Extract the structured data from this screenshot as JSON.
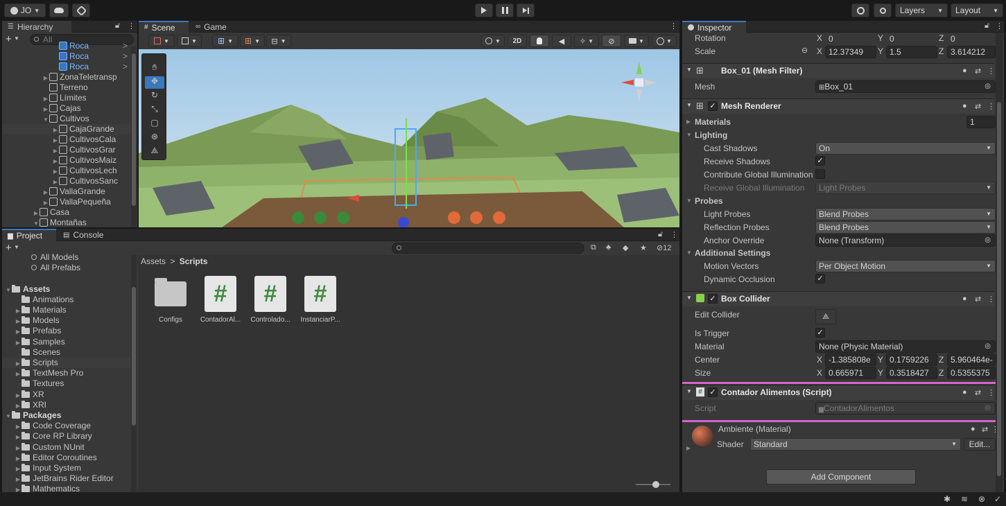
{
  "toolbar": {
    "account": "JO",
    "layers": "Layers",
    "layout": "Layout"
  },
  "hierarchy": {
    "tab": "Hierarchy",
    "search_placeholder": "All",
    "items": [
      {
        "label": "Roca",
        "indent": 5,
        "type": "blue",
        "arrow": false,
        "chev": true
      },
      {
        "label": "Roca",
        "indent": 5,
        "type": "blue",
        "arrow": false,
        "chev": true
      },
      {
        "label": "Roca",
        "indent": 5,
        "type": "blue",
        "arrow": false,
        "chev": true
      },
      {
        "label": "ZonaTeletransp",
        "indent": 4,
        "type": "cube",
        "arrow": "▶",
        "chev": false
      },
      {
        "label": "Terreno",
        "indent": 4,
        "type": "cube",
        "arrow": "",
        "chev": false
      },
      {
        "label": "Límites",
        "indent": 4,
        "type": "cube",
        "arrow": "▶",
        "chev": false
      },
      {
        "label": "Cajas",
        "indent": 4,
        "type": "cube",
        "arrow": "▶",
        "chev": false
      },
      {
        "label": "Cultivos",
        "indent": 4,
        "type": "cube",
        "arrow": "▼",
        "chev": false
      },
      {
        "label": "CajaGrande",
        "indent": 5,
        "type": "cube",
        "arrow": "▶",
        "chev": false,
        "hl": true
      },
      {
        "label": "CultivosCala",
        "indent": 5,
        "type": "cube",
        "arrow": "▶",
        "chev": false
      },
      {
        "label": "CultivosGrar",
        "indent": 5,
        "type": "cube",
        "arrow": "▶",
        "chev": false
      },
      {
        "label": "CultivosMaiz",
        "indent": 5,
        "type": "cube",
        "arrow": "▶",
        "chev": false
      },
      {
        "label": "CultivosLech",
        "indent": 5,
        "type": "cube",
        "arrow": "▶",
        "chev": false
      },
      {
        "label": "CultivosSanc",
        "indent": 5,
        "type": "cube",
        "arrow": "▶",
        "chev": false
      },
      {
        "label": "VallaGrande",
        "indent": 4,
        "type": "cube",
        "arrow": "▶",
        "chev": false
      },
      {
        "label": "VallaPequeña",
        "indent": 4,
        "type": "cube",
        "arrow": "▶",
        "chev": false
      },
      {
        "label": "Casa",
        "indent": 3,
        "type": "cube",
        "arrow": "▶",
        "chev": false
      },
      {
        "label": "Montañas",
        "indent": 3,
        "type": "cube",
        "arrow": "▼",
        "chev": false
      }
    ]
  },
  "scene": {
    "tab_scene": "Scene",
    "tab_game": "Game",
    "btn_2d": "2D"
  },
  "project": {
    "tab_project": "Project",
    "tab_console": "Console",
    "hidden_count": "12",
    "breadcrumb_root": "Assets",
    "breadcrumb_sep": ">",
    "breadcrumb_current": "Scripts",
    "tree": [
      {
        "label": "All Models",
        "indent": 2,
        "kind": "search",
        "arrow": ""
      },
      {
        "label": "All Prefabs",
        "indent": 2,
        "kind": "search",
        "arrow": ""
      },
      {
        "label": "",
        "indent": 0,
        "kind": "gap",
        "arrow": ""
      },
      {
        "label": "Assets",
        "indent": 0,
        "kind": "folder",
        "arrow": "▼",
        "bold": true
      },
      {
        "label": "Animations",
        "indent": 1,
        "kind": "folder",
        "arrow": ""
      },
      {
        "label": "Materials",
        "indent": 1,
        "kind": "folder",
        "arrow": "▶"
      },
      {
        "label": "Models",
        "indent": 1,
        "kind": "folder",
        "arrow": "▶"
      },
      {
        "label": "Prefabs",
        "indent": 1,
        "kind": "folder",
        "arrow": "▶"
      },
      {
        "label": "Samples",
        "indent": 1,
        "kind": "folder",
        "arrow": "▶"
      },
      {
        "label": "Scenes",
        "indent": 1,
        "kind": "folder",
        "arrow": ""
      },
      {
        "label": "Scripts",
        "indent": 1,
        "kind": "folder",
        "arrow": "▶",
        "hl": true
      },
      {
        "label": "TextMesh Pro",
        "indent": 1,
        "kind": "folder",
        "arrow": "▶"
      },
      {
        "label": "Textures",
        "indent": 1,
        "kind": "folder",
        "arrow": ""
      },
      {
        "label": "XR",
        "indent": 1,
        "kind": "folder",
        "arrow": "▶"
      },
      {
        "label": "XRI",
        "indent": 1,
        "kind": "folder",
        "arrow": "▶"
      },
      {
        "label": "Packages",
        "indent": 0,
        "kind": "folder",
        "arrow": "▼",
        "bold": true
      },
      {
        "label": "Code Coverage",
        "indent": 1,
        "kind": "folder",
        "arrow": "▶"
      },
      {
        "label": "Core RP Library",
        "indent": 1,
        "kind": "folder",
        "arrow": "▶"
      },
      {
        "label": "Custom NUnit",
        "indent": 1,
        "kind": "folder",
        "arrow": "▶"
      },
      {
        "label": "Editor Coroutines",
        "indent": 1,
        "kind": "folder",
        "arrow": "▶"
      },
      {
        "label": "Input System",
        "indent": 1,
        "kind": "folder",
        "arrow": "▶"
      },
      {
        "label": "JetBrains Rider Editor",
        "indent": 1,
        "kind": "folder",
        "arrow": "▶"
      },
      {
        "label": "Mathematics",
        "indent": 1,
        "kind": "folder",
        "arrow": "▶"
      }
    ],
    "assets": [
      {
        "label": "Configs",
        "kind": "folder"
      },
      {
        "label": "ContadorAl...",
        "kind": "script"
      },
      {
        "label": "Controlado...",
        "kind": "script"
      },
      {
        "label": "InstanciarP...",
        "kind": "script"
      }
    ]
  },
  "inspector": {
    "tab": "Inspector",
    "transform": {
      "rotation_label": "Rotation",
      "rotation": {
        "x": "0",
        "y": "0",
        "z": "0"
      },
      "scale_label": "Scale",
      "scale": {
        "x": "12.37349",
        "y": "1.5",
        "z": "3.614212"
      }
    },
    "mesh_filter": {
      "title": "Box_01 (Mesh Filter)",
      "mesh_label": "Mesh",
      "mesh_value": "Box_01"
    },
    "mesh_renderer": {
      "title": "Mesh Renderer",
      "materials_label": "Materials",
      "materials_count": "1",
      "lighting_label": "Lighting",
      "cast_shadows_label": "Cast Shadows",
      "cast_shadows_value": "On",
      "receive_shadows_label": "Receive Shadows",
      "contribute_gi_label": "Contribute Global Illumination",
      "receive_gi_label": "Receive Global Illumination",
      "receive_gi_value": "Light Probes",
      "probes_label": "Probes",
      "light_probes_label": "Light Probes",
      "light_probes_value": "Blend Probes",
      "reflection_probes_label": "Reflection Probes",
      "reflection_probes_value": "Blend Probes",
      "anchor_override_label": "Anchor Override",
      "anchor_override_value": "None (Transform)",
      "additional_label": "Additional Settings",
      "motion_vectors_label": "Motion Vectors",
      "motion_vectors_value": "Per Object Motion",
      "dynamic_occlusion_label": "Dynamic Occlusion"
    },
    "box_collider": {
      "title": "Box Collider",
      "edit_collider_label": "Edit Collider",
      "is_trigger_label": "Is Trigger",
      "material_label": "Material",
      "material_value": "None (Physic Material)",
      "center_label": "Center",
      "center": {
        "x": "-1.385808e",
        "y": "0.1759226",
        "z": "5.960464e-"
      },
      "size_label": "Size",
      "size": {
        "x": "0.665971",
        "y": "0.3518427",
        "z": "0.5355375"
      }
    },
    "script_component": {
      "title": "Contador Alimentos (Script)",
      "script_label": "Script",
      "script_value": "ContadorAlimentos"
    },
    "material": {
      "title": "Ambiente (Material)",
      "shader_label": "Shader",
      "shader_value": "Standard",
      "edit_label": "Edit..."
    },
    "add_component": "Add Component"
  },
  "colors": {
    "selection_outline": "#d466c8",
    "accent_blue": "#3a79bb"
  }
}
